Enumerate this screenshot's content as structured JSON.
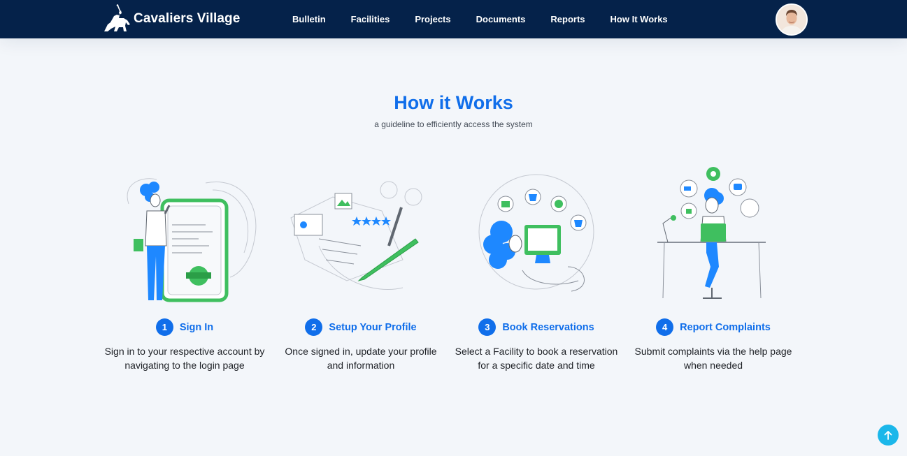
{
  "brand": {
    "name": "Cavaliers Village",
    "logo_icon": "knight-on-horse-logo"
  },
  "nav": {
    "links": [
      "Bulletin",
      "Facilities",
      "Projects",
      "Documents",
      "Reports",
      "How It Works"
    ]
  },
  "profile": {
    "icon": "user-avatar"
  },
  "section": {
    "title": "How it Works",
    "subtitle": "a guideline to efficiently access the system"
  },
  "steps": [
    {
      "number": "1",
      "title": "Sign In",
      "description": "Sign in to your respective account by navigating to the login page"
    },
    {
      "number": "2",
      "title": "Setup Your Profile",
      "description": "Once signed in, update your profile and information"
    },
    {
      "number": "3",
      "title": "Book Reservations",
      "description": "Select a Facility to book a reservation for a specific date and time"
    },
    {
      "number": "4",
      "title": "Report Complaints",
      "description": "Submit complaints via the help page when needed"
    }
  ],
  "colors": {
    "navbar": "#05224a",
    "accent": "#106eea",
    "green": "#3fbf5f",
    "background": "#f3f6fa",
    "scroll_button": "#1bb7ea"
  },
  "scroll_top": {
    "icon": "arrow-up-icon"
  }
}
